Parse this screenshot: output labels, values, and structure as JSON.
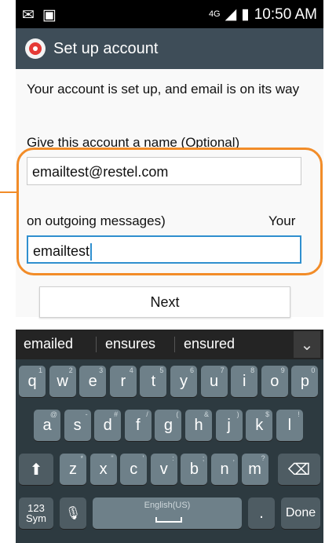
{
  "status": {
    "signal": "4G",
    "time": "10:50 AM"
  },
  "titlebar": {
    "title": "Set up account"
  },
  "message": "Your account is set up, and email is on its way",
  "account_name": {
    "label": "Give this account a name (Optional)",
    "value": "emailtest@restel.com"
  },
  "your_name": {
    "label_left": "on outgoing messages)",
    "label_right": "Your",
    "value": "emailtest"
  },
  "next_label": "Next",
  "suggestions": [
    "emailed",
    "ensures",
    "ensured"
  ],
  "keyboard": {
    "row1": [
      {
        "k": "q",
        "n": "1"
      },
      {
        "k": "w",
        "n": "2"
      },
      {
        "k": "e",
        "n": "3"
      },
      {
        "k": "r",
        "n": "4"
      },
      {
        "k": "t",
        "n": "5"
      },
      {
        "k": "y",
        "n": "6"
      },
      {
        "k": "u",
        "n": "7"
      },
      {
        "k": "i",
        "n": "8"
      },
      {
        "k": "o",
        "n": "9"
      },
      {
        "k": "p",
        "n": "0"
      }
    ],
    "row2": [
      {
        "k": "a",
        "n": "@"
      },
      {
        "k": "s",
        "n": "-"
      },
      {
        "k": "d",
        "n": "#"
      },
      {
        "k": "f",
        "n": "/"
      },
      {
        "k": "g",
        "n": "("
      },
      {
        "k": "h",
        "n": "&"
      },
      {
        "k": "j",
        "n": ")"
      },
      {
        "k": "k",
        "n": "$"
      },
      {
        "k": "l",
        "n": "!"
      }
    ],
    "row3": [
      {
        "k": "z",
        "n": "*"
      },
      {
        "k": "x",
        "n": "\""
      },
      {
        "k": "c",
        "n": "'"
      },
      {
        "k": "v",
        "n": ":"
      },
      {
        "k": "b",
        "n": ";"
      },
      {
        "k": "n",
        "n": ","
      },
      {
        "k": "m",
        "n": "?"
      }
    ],
    "sym_label": "123\nSym",
    "space_label": "English(US)",
    "done_label": "Done",
    "period_label": "."
  }
}
